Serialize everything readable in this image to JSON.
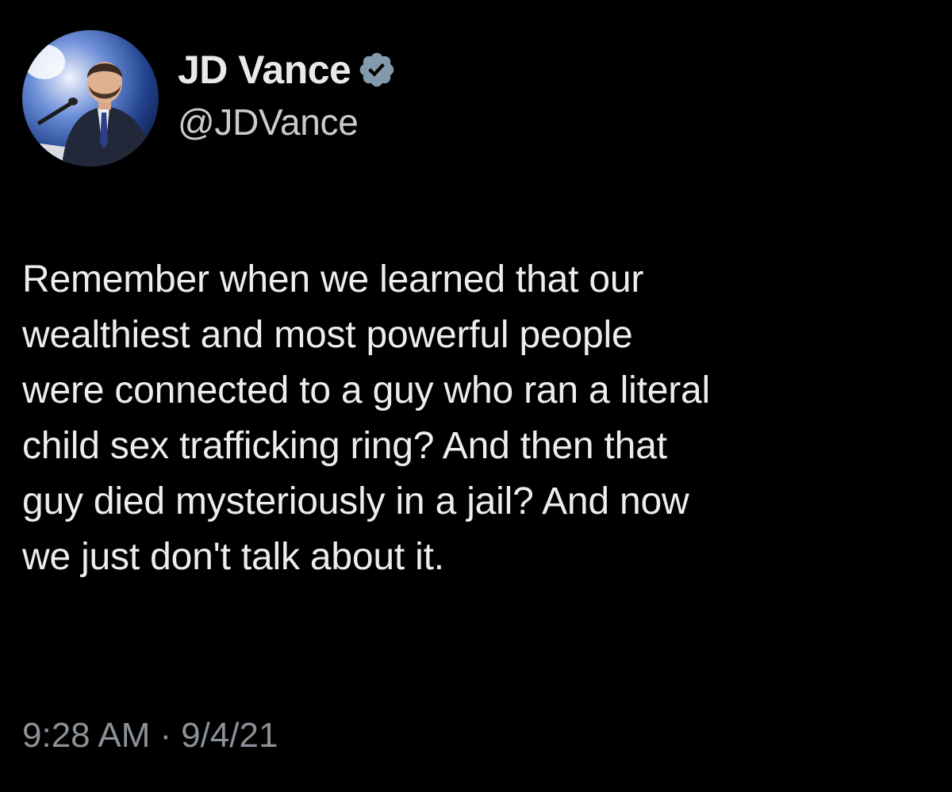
{
  "author": {
    "display_name": "JD Vance",
    "handle": "@JDVance",
    "avatar_icon": "profile-photo",
    "verified_icon": "verified-badge-icon"
  },
  "tweet": {
    "text": "Remember when we learned that our\nwealthiest and most powerful people\nwere connected to a guy who ran a literal\nchild sex trafficking ring? And then that\nguy died mysteriously in a jail? And now\nwe just don't talk about it.",
    "time": "9:28 AM",
    "separator": "·",
    "date": "9/4/21"
  },
  "colors": {
    "background": "#000000",
    "text": "#e7e9ea",
    "secondary_text": "#8b9198",
    "verified_badge": "#829aab"
  }
}
